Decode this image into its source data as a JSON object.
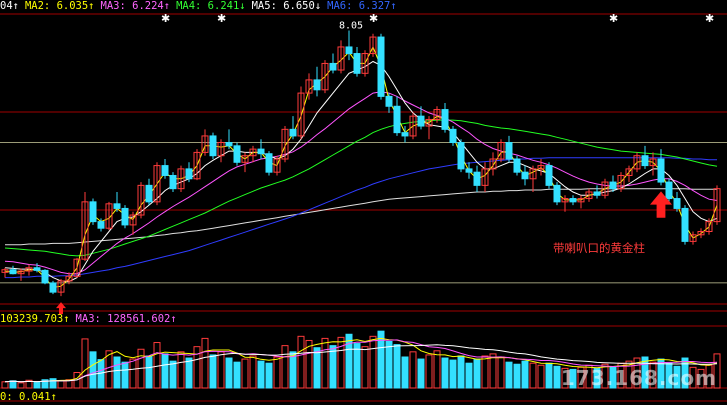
{
  "legend": {
    "main": [
      {
        "text": "04↑",
        "color": "#ffffff"
      },
      {
        "text": "MA2: 6.035↑",
        "color": "#ffff00"
      },
      {
        "text": "MA3: 6.224↑",
        "color": "#ff66ff"
      },
      {
        "text": "MA4: 6.241↓",
        "color": "#33ff33"
      },
      {
        "text": "MA5: 6.650↓",
        "color": "#ffffff"
      },
      {
        "text": "MA6: 6.327↑",
        "color": "#3366ff"
      }
    ],
    "volume": [
      {
        "text": "103239.703↑",
        "color": "#ffff00"
      },
      {
        "text": "MA3: 128561.602↑",
        "color": "#ff66ff"
      }
    ],
    "indicator": [
      {
        "text": "0: 0.041↑",
        "color": "#ffff00"
      }
    ]
  },
  "annotation": "带喇叭口的黄金柱",
  "watermark": "173.168.com",
  "colors": {
    "up": "#ff3b3b",
    "down": "#33e0ff",
    "grid": "#a00000",
    "signal": "#ffffff"
  },
  "chart_data": {
    "type": "candlestick",
    "price_max_label": "8.05",
    "ylim": [
      3.9,
      8.3
    ],
    "candles": [
      [
        4.38,
        4.45,
        4.3,
        4.42
      ],
      [
        4.42,
        4.48,
        4.35,
        4.36
      ],
      [
        4.36,
        4.44,
        4.25,
        4.4
      ],
      [
        4.4,
        4.5,
        4.33,
        4.45
      ],
      [
        4.45,
        4.52,
        4.38,
        4.41
      ],
      [
        4.41,
        4.43,
        4.2,
        4.22
      ],
      [
        4.22,
        4.25,
        4.05,
        4.08
      ],
      [
        4.08,
        4.28,
        4.02,
        4.25
      ],
      [
        4.25,
        4.38,
        4.2,
        4.32
      ],
      [
        4.32,
        4.6,
        4.3,
        4.58
      ],
      [
        4.58,
        5.6,
        4.55,
        5.45
      ],
      [
        5.45,
        5.5,
        5.1,
        5.15
      ],
      [
        5.15,
        5.2,
        5.0,
        5.05
      ],
      [
        5.05,
        5.45,
        5.02,
        5.42
      ],
      [
        5.42,
        5.6,
        5.3,
        5.35
      ],
      [
        5.35,
        5.4,
        5.05,
        5.1
      ],
      [
        5.1,
        5.3,
        4.95,
        5.25
      ],
      [
        5.25,
        5.75,
        5.2,
        5.7
      ],
      [
        5.7,
        5.8,
        5.4,
        5.45
      ],
      [
        5.45,
        6.05,
        5.4,
        6.0
      ],
      [
        6.0,
        6.1,
        5.8,
        5.85
      ],
      [
        5.85,
        5.9,
        5.6,
        5.65
      ],
      [
        5.65,
        6.0,
        5.6,
        5.95
      ],
      [
        5.95,
        6.05,
        5.75,
        5.8
      ],
      [
        5.8,
        6.25,
        5.78,
        6.2
      ],
      [
        6.2,
        6.55,
        6.15,
        6.45
      ],
      [
        6.45,
        6.5,
        6.1,
        6.15
      ],
      [
        6.15,
        6.4,
        6.05,
        6.35
      ],
      [
        6.35,
        6.55,
        6.25,
        6.3
      ],
      [
        6.3,
        6.35,
        6.0,
        6.05
      ],
      [
        6.05,
        6.2,
        5.9,
        6.15
      ],
      [
        6.15,
        6.3,
        6.05,
        6.25
      ],
      [
        6.25,
        6.4,
        6.1,
        6.18
      ],
      [
        6.18,
        6.22,
        5.85,
        5.9
      ],
      [
        5.9,
        6.15,
        5.85,
        6.1
      ],
      [
        6.1,
        6.6,
        6.05,
        6.55
      ],
      [
        6.55,
        6.75,
        6.4,
        6.45
      ],
      [
        6.45,
        7.2,
        6.4,
        7.1
      ],
      [
        7.1,
        7.4,
        7.0,
        7.3
      ],
      [
        7.3,
        7.5,
        7.05,
        7.15
      ],
      [
        7.15,
        7.6,
        7.1,
        7.55
      ],
      [
        7.55,
        7.7,
        7.4,
        7.45
      ],
      [
        7.45,
        7.9,
        7.4,
        7.8
      ],
      [
        7.8,
        8.05,
        7.6,
        7.7
      ],
      [
        7.7,
        7.8,
        7.35,
        7.4
      ],
      [
        7.4,
        7.75,
        7.35,
        7.7
      ],
      [
        7.7,
        8.0,
        7.65,
        7.95
      ],
      [
        7.95,
        8.0,
        7.0,
        7.05
      ],
      [
        7.05,
        7.1,
        6.8,
        6.9
      ],
      [
        6.9,
        7.05,
        6.45,
        6.5
      ],
      [
        6.5,
        6.6,
        6.35,
        6.45
      ],
      [
        6.45,
        6.8,
        6.4,
        6.75
      ],
      [
        6.75,
        6.9,
        6.55,
        6.6
      ],
      [
        6.6,
        6.75,
        6.4,
        6.7
      ],
      [
        6.7,
        6.9,
        6.65,
        6.85
      ],
      [
        6.85,
        6.95,
        6.5,
        6.55
      ],
      [
        6.55,
        6.6,
        6.3,
        6.35
      ],
      [
        6.35,
        6.4,
        5.9,
        5.95
      ],
      [
        5.95,
        6.05,
        5.8,
        5.9
      ],
      [
        5.9,
        6.0,
        5.6,
        5.7
      ],
      [
        5.7,
        6.05,
        5.6,
        5.95
      ],
      [
        5.95,
        6.2,
        5.85,
        6.1
      ],
      [
        6.1,
        6.4,
        6.05,
        6.35
      ],
      [
        6.35,
        6.45,
        6.05,
        6.1
      ],
      [
        6.1,
        6.15,
        5.85,
        5.9
      ],
      [
        5.9,
        6.0,
        5.7,
        5.8
      ],
      [
        5.8,
        6.0,
        5.6,
        5.95
      ],
      [
        5.95,
        6.1,
        5.85,
        6.0
      ],
      [
        6.0,
        6.05,
        5.65,
        5.7
      ],
      [
        5.7,
        5.75,
        5.4,
        5.45
      ],
      [
        5.45,
        5.55,
        5.3,
        5.5
      ],
      [
        5.5,
        5.55,
        5.4,
        5.45
      ],
      [
        5.45,
        5.55,
        5.35,
        5.5
      ],
      [
        5.5,
        5.65,
        5.45,
        5.6
      ],
      [
        5.6,
        5.7,
        5.5,
        5.55
      ],
      [
        5.55,
        5.8,
        5.5,
        5.75
      ],
      [
        5.75,
        5.85,
        5.6,
        5.65
      ],
      [
        5.65,
        5.9,
        5.6,
        5.85
      ],
      [
        5.85,
        6.0,
        5.75,
        5.95
      ],
      [
        5.95,
        6.2,
        5.9,
        6.15
      ],
      [
        6.15,
        6.3,
        5.95,
        6.0
      ],
      [
        6.0,
        6.2,
        5.85,
        6.1
      ],
      [
        6.1,
        6.25,
        5.7,
        5.75
      ],
      [
        5.75,
        5.8,
        5.45,
        5.5
      ],
      [
        5.5,
        5.6,
        5.3,
        5.35
      ],
      [
        5.35,
        5.4,
        4.8,
        4.85
      ],
      [
        4.85,
        5.0,
        4.8,
        4.95
      ],
      [
        4.95,
        5.05,
        4.9,
        5.0
      ],
      [
        5.0,
        5.2,
        4.95,
        5.15
      ],
      [
        5.15,
        5.7,
        5.1,
        5.65
      ]
    ],
    "ma_short": [
      4.4,
      4.38,
      4.39,
      4.42,
      4.42,
      4.3,
      4.15,
      4.17,
      4.28,
      4.45,
      4.95,
      5.25,
      5.15,
      5.2,
      5.35,
      5.25,
      5.18,
      5.4,
      5.55,
      5.72,
      5.9,
      5.8,
      5.8,
      5.85,
      6.0,
      6.3,
      6.3,
      6.28,
      6.3,
      6.18,
      6.1,
      6.2,
      6.2,
      6.05,
      6.0,
      6.3,
      6.48,
      6.75,
      7.15,
      7.25,
      7.35,
      7.5,
      7.6,
      7.72,
      7.55,
      7.55,
      7.8,
      7.5,
      7.0,
      6.75,
      6.5,
      6.6,
      6.65,
      6.65,
      6.75,
      6.7,
      6.45,
      6.15,
      5.92,
      5.8,
      5.85,
      6.0,
      6.2,
      6.22,
      6.0,
      5.85,
      5.9,
      5.97,
      5.85,
      5.58,
      5.48,
      5.48,
      5.48,
      5.55,
      5.58,
      5.65,
      5.7,
      5.75,
      5.9,
      6.05,
      6.08,
      6.05,
      5.92,
      5.62,
      5.42,
      5.1,
      4.9,
      4.97,
      5.07,
      5.4
    ],
    "ma_mid": [
      4.45,
      4.44,
      4.43,
      4.43,
      4.42,
      4.38,
      4.3,
      4.25,
      4.24,
      4.3,
      4.5,
      4.7,
      4.85,
      5.0,
      5.15,
      5.2,
      5.22,
      5.3,
      5.4,
      5.5,
      5.62,
      5.7,
      5.75,
      5.8,
      5.88,
      6.0,
      6.08,
      6.15,
      6.22,
      6.22,
      6.2,
      6.2,
      6.2,
      6.15,
      6.1,
      6.15,
      6.25,
      6.4,
      6.6,
      6.8,
      6.95,
      7.1,
      7.25,
      7.4,
      7.45,
      7.5,
      7.58,
      7.52,
      7.35,
      7.15,
      6.95,
      6.8,
      6.7,
      6.62,
      6.6,
      6.58,
      6.5,
      6.35,
      6.2,
      6.05,
      5.95,
      5.95,
      6.0,
      6.05,
      6.05,
      6.0,
      5.95,
      5.92,
      5.88,
      5.78,
      5.68,
      5.6,
      5.55,
      5.55,
      5.57,
      5.6,
      5.62,
      5.66,
      5.72,
      5.8,
      5.88,
      5.95,
      5.95,
      5.85,
      5.7,
      5.5,
      5.3,
      5.2,
      5.15,
      5.2
    ],
    "ma_long": [
      4.55,
      4.54,
      4.52,
      4.5,
      4.49,
      4.46,
      4.42,
      4.38,
      4.36,
      4.36,
      4.42,
      4.52,
      4.62,
      4.72,
      4.82,
      4.9,
      4.97,
      5.05,
      5.13,
      5.22,
      5.3,
      5.38,
      5.45,
      5.52,
      5.6,
      5.68,
      5.76,
      5.84,
      5.92,
      5.98,
      6.02,
      6.06,
      6.1,
      6.12,
      6.14,
      6.17,
      6.21,
      6.28,
      6.37,
      6.47,
      6.56,
      6.66,
      6.76,
      6.86,
      6.94,
      7.02,
      7.1,
      7.12,
      7.1,
      7.05,
      6.98,
      6.92,
      6.86,
      6.8,
      6.76,
      6.72,
      6.66,
      6.58,
      6.5,
      6.4,
      6.32,
      6.26,
      6.22,
      6.19,
      6.16,
      6.12,
      6.08,
      6.05,
      6.01,
      5.96,
      5.9,
      5.84,
      5.79,
      5.75,
      5.72,
      5.7,
      5.69,
      5.69,
      5.7,
      5.72,
      5.75,
      5.78,
      5.8,
      5.8,
      5.76,
      5.7,
      5.62,
      5.55,
      5.49,
      5.47
    ],
    "ma_60": [
      4.75,
      4.74,
      4.73,
      4.72,
      4.71,
      4.7,
      4.68,
      4.66,
      4.64,
      4.63,
      4.64,
      4.67,
      4.7,
      4.73,
      4.77,
      4.81,
      4.85,
      4.89,
      4.93,
      4.98,
      5.03,
      5.08,
      5.13,
      5.18,
      5.23,
      5.28,
      5.34,
      5.4,
      5.46,
      5.51,
      5.56,
      5.61,
      5.66,
      5.7,
      5.74,
      5.78,
      5.83,
      5.89,
      5.95,
      6.02,
      6.09,
      6.16,
      6.23,
      6.3,
      6.37,
      6.43,
      6.5,
      6.55,
      6.59,
      6.62,
      6.64,
      6.66,
      6.67,
      6.68,
      6.69,
      6.69,
      6.69,
      6.68,
      6.66,
      6.64,
      6.61,
      6.59,
      6.57,
      6.56,
      6.54,
      6.52,
      6.5,
      6.48,
      6.46,
      6.43,
      6.4,
      6.37,
      6.34,
      6.31,
      6.28,
      6.26,
      6.24,
      6.22,
      6.21,
      6.2,
      6.19,
      6.18,
      6.17,
      6.15,
      6.13,
      6.1,
      6.07,
      6.04,
      6.01,
      5.99
    ],
    "ma_120": [
      4.3,
      4.3,
      4.31,
      4.31,
      4.32,
      4.32,
      4.32,
      4.33,
      4.33,
      4.34,
      4.36,
      4.38,
      4.4,
      4.42,
      4.45,
      4.47,
      4.5,
      4.53,
      4.56,
      4.59,
      4.62,
      4.65,
      4.68,
      4.71,
      4.75,
      4.79,
      4.83,
      4.87,
      4.91,
      4.95,
      4.99,
      5.03,
      5.07,
      5.11,
      5.15,
      5.19,
      5.23,
      5.28,
      5.33,
      5.38,
      5.43,
      5.48,
      5.53,
      5.58,
      5.63,
      5.67,
      5.72,
      5.76,
      5.8,
      5.83,
      5.86,
      5.89,
      5.92,
      5.95,
      5.97,
      5.99,
      6.01,
      6.03,
      6.04,
      6.05,
      6.06,
      6.07,
      6.08,
      6.09,
      6.1,
      6.1,
      6.11,
      6.11,
      6.12,
      6.12,
      6.12,
      6.12,
      6.12,
      6.12,
      6.12,
      6.12,
      6.12,
      6.12,
      6.12,
      6.12,
      6.12,
      6.12,
      6.12,
      6.12,
      6.11,
      6.11,
      6.1,
      6.1,
      6.09,
      6.09
    ],
    "ma_250": [
      4.8,
      4.8,
      4.8,
      4.81,
      4.81,
      4.81,
      4.82,
      4.82,
      4.82,
      4.83,
      4.84,
      4.85,
      4.86,
      4.87,
      4.88,
      4.89,
      4.9,
      4.91,
      4.92,
      4.94,
      4.95,
      4.97,
      4.98,
      5.0,
      5.01,
      5.03,
      5.05,
      5.07,
      5.09,
      5.11,
      5.13,
      5.15,
      5.17,
      5.19,
      5.21,
      5.23,
      5.25,
      5.27,
      5.29,
      5.31,
      5.33,
      5.35,
      5.37,
      5.39,
      5.41,
      5.43,
      5.45,
      5.47,
      5.49,
      5.5,
      5.51,
      5.52,
      5.53,
      5.54,
      5.55,
      5.56,
      5.57,
      5.58,
      5.59,
      5.6,
      5.6,
      5.61,
      5.61,
      5.62,
      5.62,
      5.63,
      5.63,
      5.63,
      5.64,
      5.64,
      5.64,
      5.64,
      5.64,
      5.65,
      5.65,
      5.65,
      5.65,
      5.65,
      5.65,
      5.65,
      5.65,
      5.65,
      5.65,
      5.65,
      5.65,
      5.65,
      5.64,
      5.64,
      5.64,
      5.64
    ],
    "volumes": [
      12,
      14,
      10,
      15,
      11,
      16,
      18,
      14,
      16,
      30,
      95,
      70,
      55,
      72,
      60,
      50,
      56,
      75,
      62,
      88,
      66,
      52,
      70,
      58,
      80,
      96,
      64,
      70,
      58,
      50,
      56,
      62,
      52,
      48,
      60,
      82,
      70,
      100,
      92,
      78,
      96,
      82,
      98,
      104,
      86,
      80,
      100,
      110,
      90,
      84,
      60,
      70,
      56,
      64,
      72,
      58,
      54,
      62,
      48,
      56,
      62,
      66,
      60,
      50,
      46,
      52,
      48,
      44,
      48,
      42,
      38,
      36,
      40,
      44,
      38,
      46,
      40,
      48,
      52,
      58,
      60,
      50,
      56,
      48,
      42,
      58,
      40,
      36,
      44,
      66
    ],
    "volume_ylim": [
      0,
      120
    ],
    "horizontal_levels": [
      4.22,
      6.35
    ],
    "signal_bars": [
      20,
      27,
      46,
      76,
      88
    ],
    "up_arrow_bars": [
      7,
      82
    ]
  }
}
